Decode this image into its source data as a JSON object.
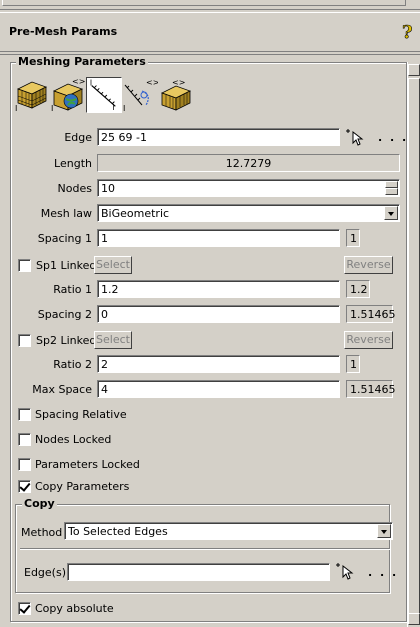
{
  "window": {
    "title": "Pre-Mesh Params",
    "help_icon": "help-question-icon"
  },
  "meshing": {
    "group_title": "Meshing Parameters",
    "toolbar_icons": [
      "face-mesh-icon",
      "volume-mesh-icon",
      "edge-params-icon",
      "edge-link-icon",
      "block-params-icon"
    ],
    "edge": {
      "label": "Edge",
      "value": "25 69 -1",
      "more": ". . ."
    },
    "length": {
      "label": "Length",
      "value": "12.7279"
    },
    "nodes": {
      "label": "Nodes",
      "value": "10"
    },
    "mesh_law": {
      "label": "Mesh law",
      "value": "BiGeometric"
    },
    "spacing1": {
      "label": "Spacing 1",
      "value": "1",
      "computed": "1"
    },
    "sp1_linked": {
      "label": "Sp1 Linked",
      "checked": false,
      "select": "Select",
      "reverse": "Reverse"
    },
    "ratio1": {
      "label": "Ratio 1",
      "value": "1.2",
      "computed": "1.2"
    },
    "spacing2": {
      "label": "Spacing 2",
      "value": "0",
      "computed": "1.51465"
    },
    "sp2_linked": {
      "label": "Sp2 Linked",
      "checked": false,
      "select": "Select",
      "reverse": "Reverse"
    },
    "ratio2": {
      "label": "Ratio 2",
      "value": "2",
      "computed": "1"
    },
    "max_space": {
      "label": "Max Space",
      "value": "4",
      "computed": "1.51465"
    },
    "spacing_relative": {
      "label": "Spacing Relative",
      "checked": false
    },
    "nodes_locked": {
      "label": "Nodes Locked",
      "checked": false
    },
    "parameters_locked": {
      "label": "Parameters Locked",
      "checked": false
    },
    "copy_parameters": {
      "label": "Copy Parameters",
      "checked": true
    }
  },
  "copy": {
    "group_title": "Copy",
    "method": {
      "label": "Method",
      "value": "To Selected Edges"
    },
    "edges": {
      "label": "Edge(s)",
      "value": "",
      "more": ". . ."
    },
    "copy_absolute": {
      "label": "Copy absolute",
      "checked": true
    }
  }
}
